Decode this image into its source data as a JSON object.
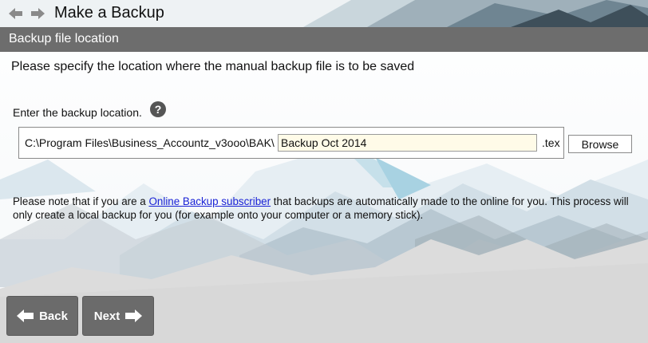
{
  "window": {
    "title": "Make a Backup"
  },
  "section": {
    "header": "Backup file location"
  },
  "content": {
    "instruction": "Please specify the location where the manual backup file is to be saved",
    "location_label": "Enter the backup location.",
    "help_icon_glyph": "?",
    "path_prefix": "C:\\Program Files\\Business_Accountz_v3ooo\\BAK\\",
    "filename_value": "Backup Oct 2014",
    "extension": ".tex",
    "browse_label": "Browse",
    "note_before_link": "Please note that if you are a ",
    "note_link": "Online Backup subscriber",
    "note_after_link": " that backups are automatically made to the online for you. This process will only create a local backup for you (for example onto your computer or a memory stick)."
  },
  "footer": {
    "back_label": "Back",
    "next_label": "Next"
  },
  "icons": {
    "nav_back": "arrow-left-icon",
    "nav_forward": "arrow-right-icon",
    "help": "question-mark-icon",
    "back_button": "arrow-left-icon",
    "next_button": "arrow-right-icon"
  },
  "colors": {
    "section_header_bg": "#6d6d6d",
    "button_bg": "#6b6b6b",
    "input_bg": "#fffbe8",
    "link": "#1a22d6"
  }
}
